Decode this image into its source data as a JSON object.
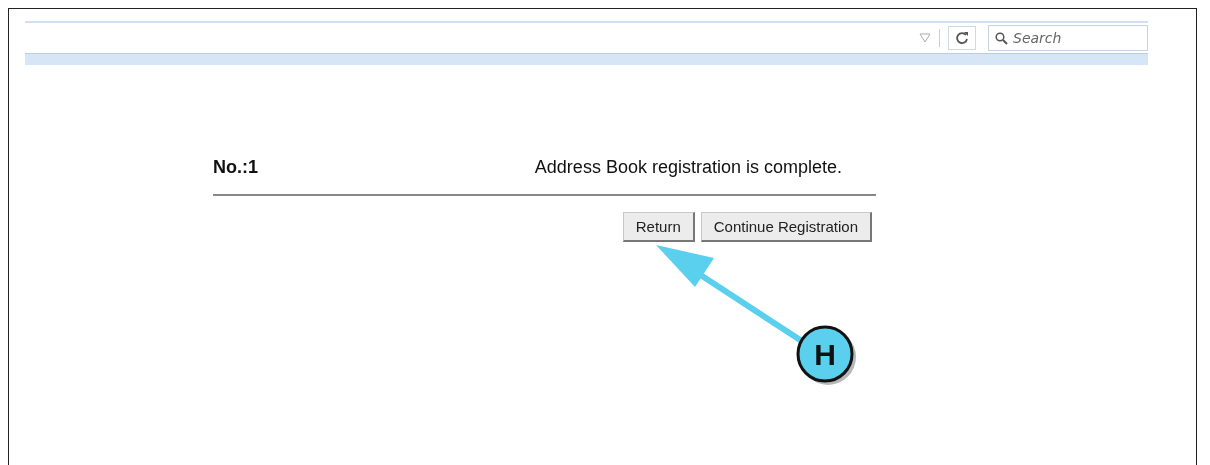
{
  "browser_toolbar": {
    "search": {
      "placeholder": "Search"
    }
  },
  "result": {
    "number": "No.:1",
    "message": "Address Book registration is complete."
  },
  "buttons": [
    "Return",
    "Continue Registration"
  ],
  "callout": {
    "label": "H"
  }
}
